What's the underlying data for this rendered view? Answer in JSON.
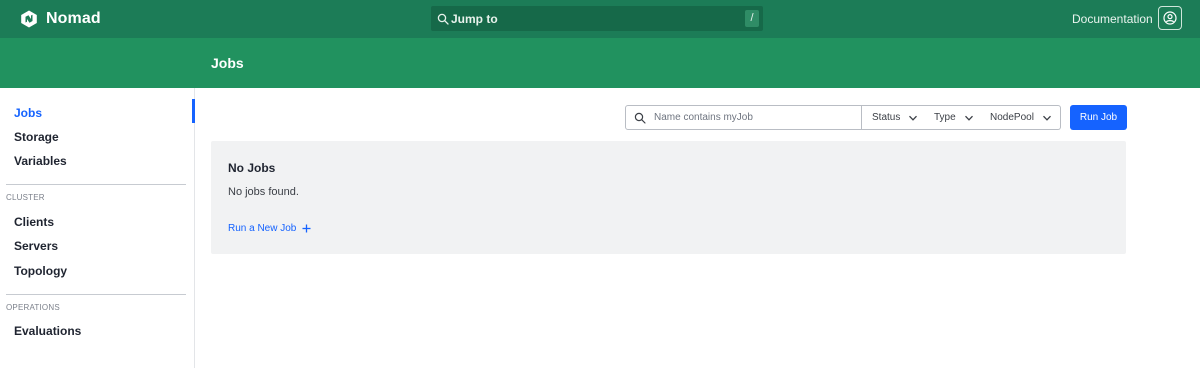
{
  "topnav": {
    "brand": "Nomad",
    "jump_label": "Jump to",
    "jump_shortcut": "/",
    "documentation": "Documentation",
    "user_icon": "user-circle-icon"
  },
  "page": {
    "title": "Jobs"
  },
  "sidebar": {
    "items": [
      {
        "label": "Jobs",
        "active": true
      },
      {
        "label": "Storage"
      },
      {
        "label": "Variables"
      }
    ],
    "cluster_title": "CLUSTER",
    "cluster_items": [
      {
        "label": "Clients"
      },
      {
        "label": "Servers"
      },
      {
        "label": "Topology"
      }
    ],
    "operations_title": "OPERATIONS",
    "operations_items": [
      {
        "label": "Evaluations"
      }
    ]
  },
  "toolbar": {
    "search_placeholder": "Name contains myJob",
    "filters": [
      {
        "label": "Status"
      },
      {
        "label": "Type"
      },
      {
        "label": "NodePool"
      }
    ],
    "run_label": "Run Job"
  },
  "empty_state": {
    "title": "No Jobs",
    "message": "No jobs found.",
    "link_label": "Run a New Job",
    "link_icon": "plus-icon"
  },
  "colors": {
    "nav_bg": "#1c7c57",
    "subheader_bg": "#21925f",
    "accent": "#1563ff",
    "empty_bg": "#f1f2f3"
  }
}
